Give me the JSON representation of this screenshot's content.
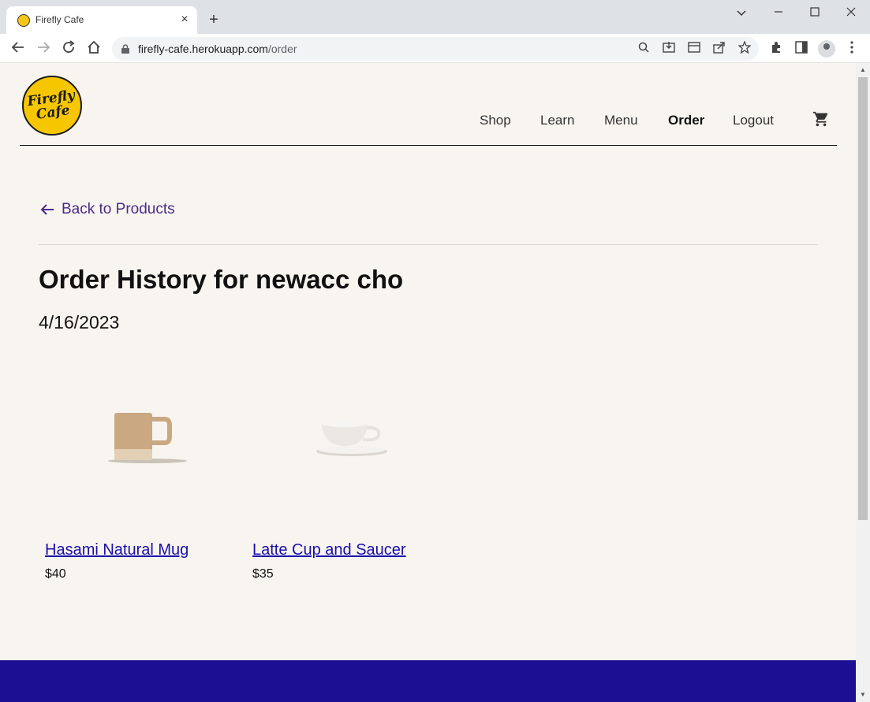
{
  "browser": {
    "tab_title": "Firefly Cafe",
    "tab_close": "×",
    "new_tab": "+",
    "url_host": "firefly-cafe.herokuapp.com",
    "url_path": "/order",
    "window_controls": [
      "chevron-down-icon",
      "minimize-icon",
      "maximize-icon",
      "close-icon"
    ]
  },
  "site": {
    "logo_text": "Firefly Cafe",
    "nav": [
      {
        "label": "Shop"
      },
      {
        "label": "Learn"
      },
      {
        "label": "Menu"
      },
      {
        "label": "Order",
        "active": true
      },
      {
        "label": "Logout"
      }
    ]
  },
  "main": {
    "back_label": "Back to Products",
    "title": "Order History for newacc cho",
    "order_date": "4/16/2023",
    "products": [
      {
        "name": "Hasami Natural Mug",
        "price": "$40"
      },
      {
        "name": "Latte Cup and Saucer",
        "price": "$35"
      }
    ]
  },
  "colors": {
    "accent": "#4b2a8a",
    "footer": "#1c0f93",
    "page_bg": "#f8f5f0",
    "link": "#1a0dab"
  }
}
